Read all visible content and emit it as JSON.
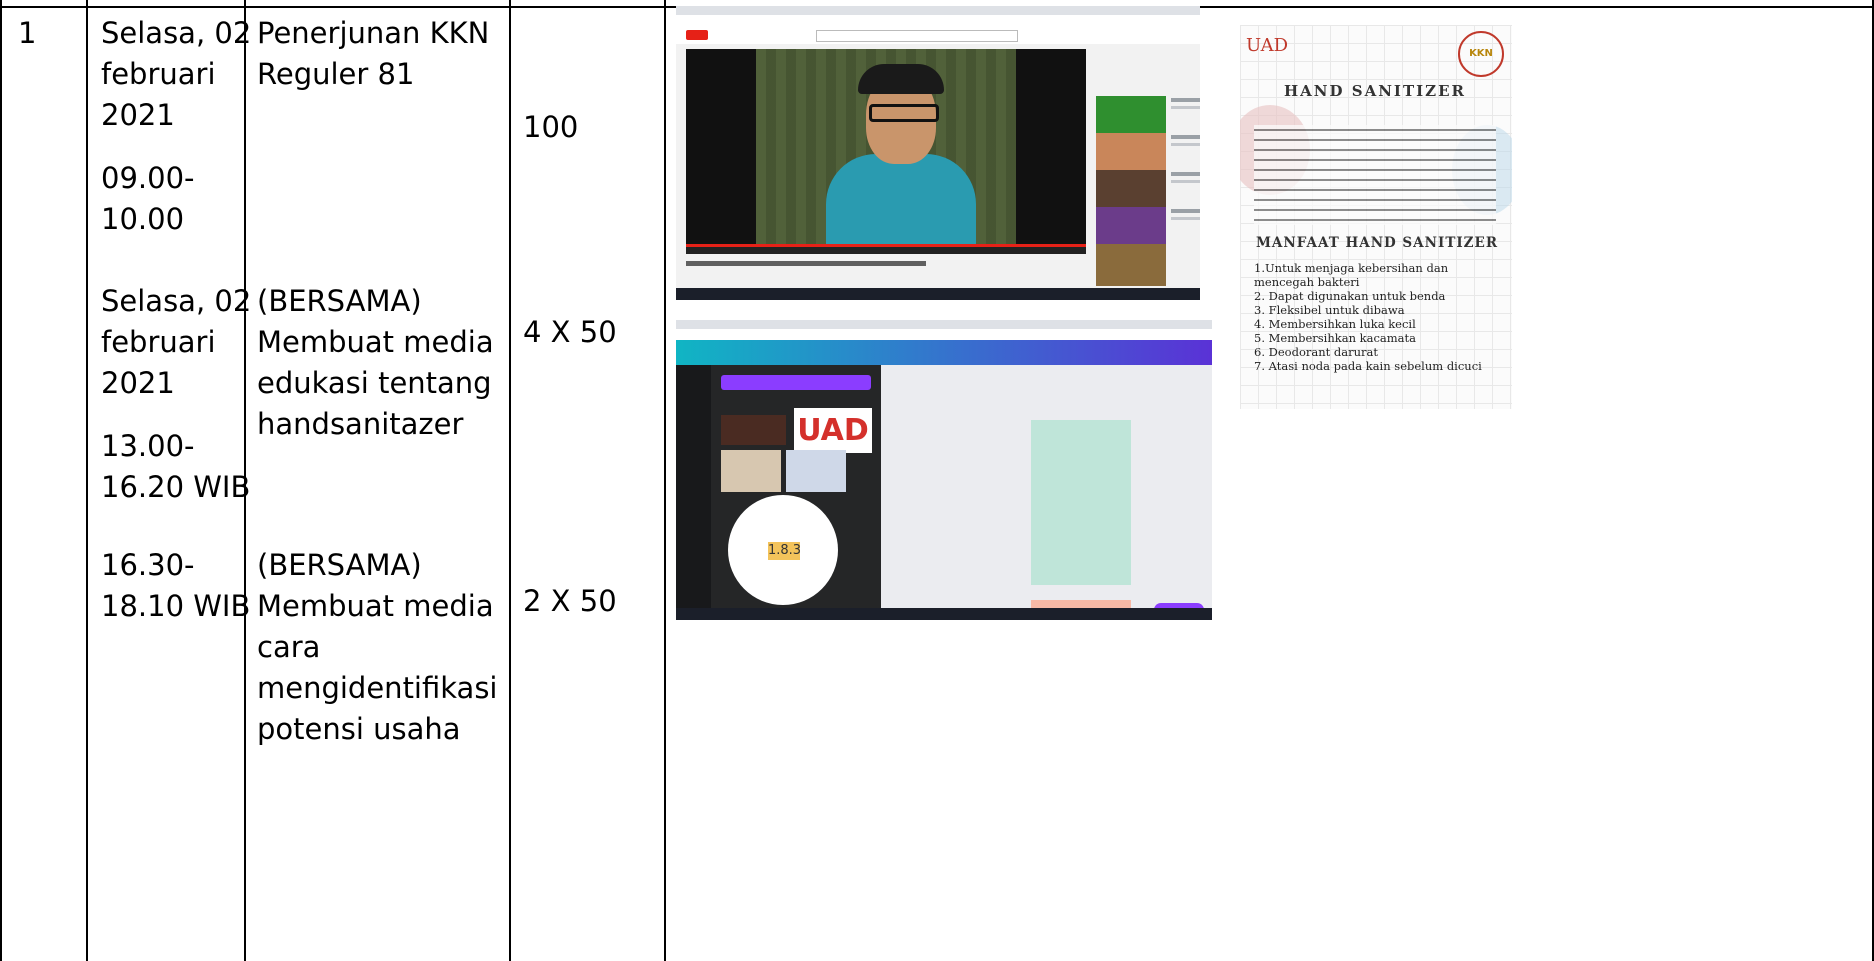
{
  "table": {
    "row": {
      "number": "1",
      "dates": {
        "first": [
          "Selasa, 02",
          "februari",
          "2021"
        ],
        "first_time": [
          "09.00-",
          "10.00"
        ],
        "second": [
          "Selasa, 02",
          "februari",
          "2021"
        ],
        "second_time": [
          "13.00-",
          "16.20 WIB"
        ],
        "third_time": [
          "16.30-",
          "18.10 WIB"
        ]
      },
      "activities": {
        "first": [
          "Penerjunan KKN",
          "Reguler 81"
        ],
        "second": [
          "(BERSAMA)",
          "Membuat media",
          "edukasi tentang",
          "handsanitazer"
        ],
        "third": [
          "(BERSAMA)",
          "Membuat media",
          "cara",
          "mengidentifikasi",
          "potensi usaha"
        ]
      },
      "durations": {
        "first": "100",
        "second": "4 X 50",
        "third": "2 X 50"
      }
    }
  },
  "screenshots": {
    "canva_logo_text": "UAD",
    "canva_circle_number": "1.8.3"
  },
  "poster": {
    "logo": "UAD",
    "seal": "KKN",
    "title": "HAND SANITIZER",
    "subtitle": "MANFAAT HAND SANITIZER",
    "items": [
      "1.Untuk menjaga kebersihan dan",
      "mencegah bakteri",
      "2. Dapat digunakan untuk benda",
      "3. Fleksibel untuk dibawa",
      "4. Membersihkan luka kecil",
      "5. Membersihkan kacamata",
      "6. Deodorant darurat",
      "7. Atasi noda pada kain sebelum dicuci"
    ]
  }
}
